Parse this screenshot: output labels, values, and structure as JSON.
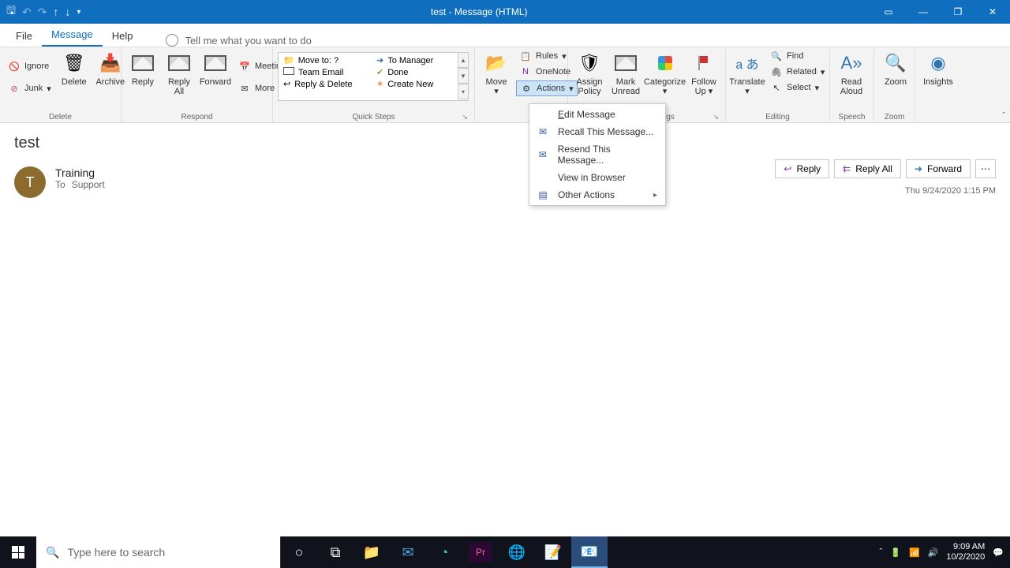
{
  "titlebar": {
    "title": "test  -  Message (HTML)"
  },
  "tabs": {
    "file": "File",
    "message": "Message",
    "help": "Help",
    "tellme": "Tell me what you want to do"
  },
  "ribbon": {
    "delete": {
      "ignore": "Ignore",
      "junk": "Junk",
      "delete": "Delete",
      "archive": "Archive",
      "label": "Delete"
    },
    "respond": {
      "reply": "Reply",
      "replyall": "Reply\nAll",
      "forward": "Forward",
      "meeting": "Meeting",
      "more": "More",
      "label": "Respond"
    },
    "quicksteps": {
      "moveto": "Move to: ?",
      "teamemail": "Team Email",
      "replydelete": "Reply & Delete",
      "tomanager": "To Manager",
      "done": "Done",
      "createnew": "Create New",
      "label": "Quick Steps"
    },
    "move": {
      "move": "Move",
      "rules": "Rules",
      "onenote": "OneNote",
      "actions": "Actions",
      "label_suffix": "gs"
    },
    "tags": {
      "assign": "Assign\nPolicy",
      "mark": "Mark\nUnread",
      "categorize": "Categorize",
      "followup": "Follow\nUp"
    },
    "editing": {
      "translate": "Translate",
      "find": "Find",
      "related": "Related",
      "select": "Select",
      "label": "Editing"
    },
    "speech": {
      "read": "Read\nAloud",
      "label": "Speech"
    },
    "zoom": {
      "zoom": "Zoom",
      "label": "Zoom"
    },
    "insights": {
      "insights": "Insights"
    }
  },
  "dropdown": {
    "edit": "Edit Message",
    "recall": "Recall This Message...",
    "resend": "Resend This Message...",
    "viewbrowser": "View in Browser",
    "other": "Other Actions"
  },
  "message": {
    "subject": "test",
    "from": "Training",
    "to_label": "To",
    "to_value": "Support",
    "avatar_letter": "T",
    "reply": "Reply",
    "replyall": "Reply All",
    "forward": "Forward",
    "timestamp": "Thu 9/24/2020 1:15 PM"
  },
  "taskbar": {
    "search_placeholder": "Type here to search",
    "time": "9:09 AM",
    "date": "10/2/2020"
  }
}
